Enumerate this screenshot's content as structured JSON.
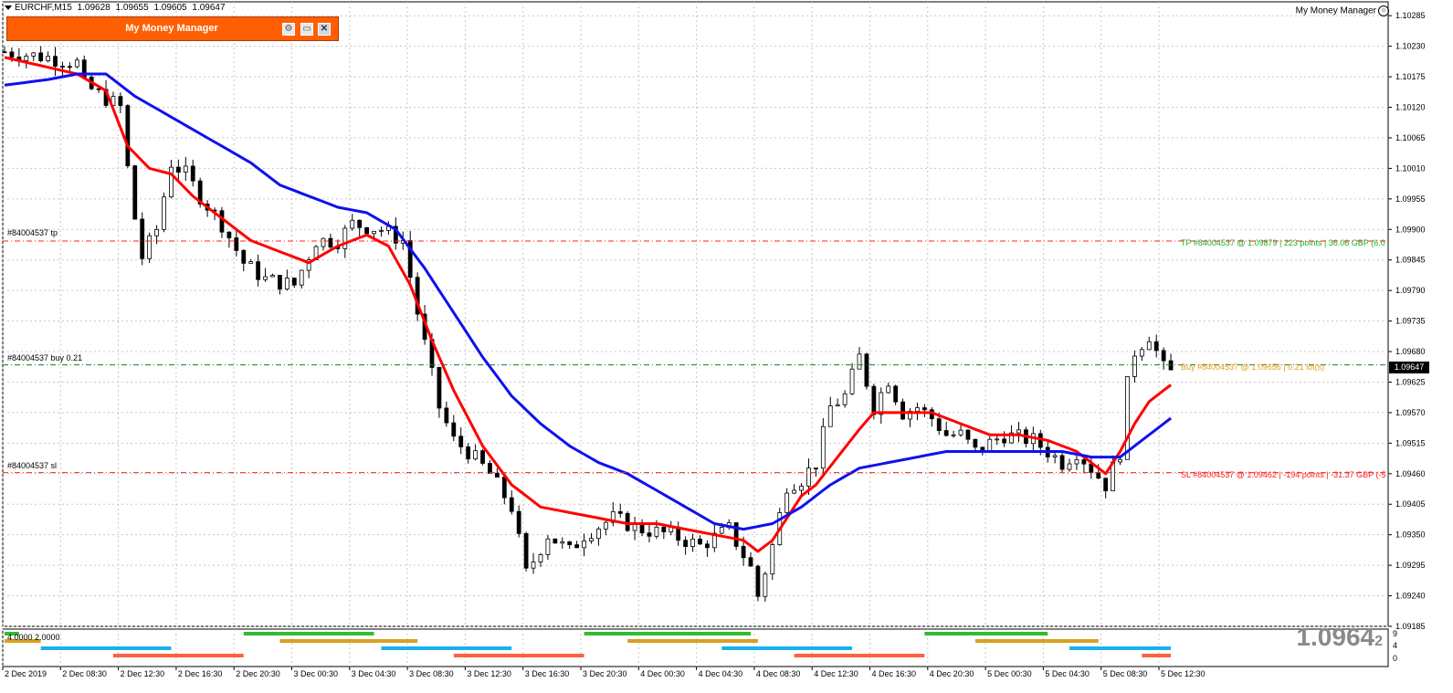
{
  "header": {
    "symbol": "EURCHF,M15",
    "open": "1.09628",
    "high": "1.09655",
    "low": "1.09605",
    "close": "1.09647"
  },
  "window_label": "My Money Manager",
  "panel": {
    "title": "My Money Manager"
  },
  "current_price": {
    "big": "1.0964",
    "big_small": "2",
    "tag": "1.09647"
  },
  "order_lines": {
    "tp": {
      "left": "#84004537 tp",
      "right": "TP #84004537 @ 1.09879 | 223 points | 36.06 GBP (6.0"
    },
    "buy": {
      "left": "#84004537 buy 0.21",
      "right": "Buy #84004537 @ 1.09656 | 0.21 lot(s)"
    },
    "sl": {
      "left": "#84004537 sl",
      "right": "SL #84004537 @ 1.09462 | -194 points | -31.37 GBP (-5"
    }
  },
  "indicator": {
    "label": "4.0000 2.0000",
    "scale": [
      "9",
      "4",
      "0"
    ]
  },
  "colors": {
    "candle": "#000000",
    "fast_ma": "#ff0000",
    "slow_ma": "#1010ee",
    "tp": "#22aa22",
    "buy": "#e0a020",
    "sl": "#ff0000",
    "panel": "#ff5f00"
  },
  "chart_data": {
    "type": "candlestick",
    "symbol": "EURCHF",
    "timeframe": "M15",
    "ylim": [
      1.09185,
      1.1031
    ],
    "y_ticks": [
      "1.10285",
      "1.10230",
      "1.10175",
      "1.10120",
      "1.10065",
      "1.10010",
      "1.09955",
      "1.09900",
      "1.09845",
      "1.09790",
      "1.09735",
      "1.09680",
      "1.09625",
      "1.09570",
      "1.09515",
      "1.09460",
      "1.09405",
      "1.09350",
      "1.09295",
      "1.09240",
      "1.09185"
    ],
    "x_ticks": [
      "2 Dec 2019",
      "2 Dec 08:30",
      "2 Dec 12:30",
      "2 Dec 16:30",
      "2 Dec 20:30",
      "3 Dec 00:30",
      "3 Dec 04:30",
      "3 Dec 08:30",
      "3 Dec 12:30",
      "3 Dec 16:30",
      "3 Dec 20:30",
      "4 Dec 00:30",
      "4 Dec 04:30",
      "4 Dec 08:30",
      "4 Dec 12:30",
      "4 Dec 16:30",
      "4 Dec 20:30",
      "5 Dec 00:30",
      "5 Dec 04:30",
      "5 Dec 08:30",
      "5 Dec 12:30"
    ],
    "price_path": [
      [
        0,
        1.1022
      ],
      [
        6,
        1.1021
      ],
      [
        10,
        1.102
      ],
      [
        11,
        1.1016
      ],
      [
        16,
        1.1012
      ],
      [
        17,
        1.1001
      ],
      [
        18,
        1.0992
      ],
      [
        19,
        1.0985
      ],
      [
        21,
        1.099
      ],
      [
        23,
        1.1002
      ],
      [
        25,
        1.1
      ],
      [
        27,
        1.0996
      ],
      [
        30,
        1.0991
      ],
      [
        33,
        1.0984
      ],
      [
        36,
        1.0981
      ],
      [
        40,
        1.098
      ],
      [
        43,
        1.0988
      ],
      [
        46,
        1.0988
      ],
      [
        48,
        1.0991
      ],
      [
        52,
        1.099
      ],
      [
        55,
        1.0988
      ],
      [
        57,
        1.0975
      ],
      [
        60,
        1.0958
      ],
      [
        62,
        1.0952
      ],
      [
        64,
        1.095
      ],
      [
        67,
        1.0946
      ],
      [
        70,
        1.094
      ],
      [
        72,
        1.0928
      ],
      [
        75,
        1.0935
      ],
      [
        78,
        1.0932
      ],
      [
        80,
        1.0935
      ],
      [
        84,
        1.0938
      ],
      [
        88,
        1.0936
      ],
      [
        92,
        1.0935
      ],
      [
        96,
        1.0933
      ],
      [
        100,
        1.0936
      ],
      [
        103,
        1.0929
      ],
      [
        104,
        1.0924
      ],
      [
        106,
        1.0933
      ],
      [
        108,
        1.0944
      ],
      [
        110,
        1.0945
      ],
      [
        112,
        1.0948
      ],
      [
        114,
        1.0958
      ],
      [
        116,
        1.096
      ],
      [
        118,
        1.0967
      ],
      [
        120,
        1.0958
      ],
      [
        122,
        1.0963
      ],
      [
        124,
        1.0957
      ],
      [
        126,
        1.0958
      ],
      [
        128,
        1.0956
      ],
      [
        130,
        1.0953
      ],
      [
        132,
        1.0953
      ],
      [
        134,
        1.095
      ],
      [
        138,
        1.0953
      ],
      [
        142,
        1.0952
      ],
      [
        144,
        1.095
      ],
      [
        146,
        1.0948
      ],
      [
        148,
        1.095
      ],
      [
        150,
        1.0947
      ],
      [
        152,
        1.0944
      ],
      [
        154,
        1.095
      ],
      [
        155,
        1.0962
      ],
      [
        156,
        1.0968
      ],
      [
        158,
        1.0971
      ],
      [
        160,
        1.0965
      ],
      [
        161,
        1.0964
      ]
    ],
    "series": [
      {
        "name": "fast MA",
        "path": [
          [
            0,
            1.1021
          ],
          [
            10,
            1.1018
          ],
          [
            14,
            1.1015
          ],
          [
            17,
            1.1005
          ],
          [
            20,
            1.1001
          ],
          [
            23,
            1.1
          ],
          [
            26,
            1.0996
          ],
          [
            30,
            1.0992
          ],
          [
            34,
            1.0988
          ],
          [
            38,
            1.0986
          ],
          [
            42,
            1.0984
          ],
          [
            46,
            1.0987
          ],
          [
            50,
            1.0989
          ],
          [
            53,
            1.0987
          ],
          [
            56,
            1.098
          ],
          [
            59,
            1.097
          ],
          [
            62,
            1.0961
          ],
          [
            66,
            1.0951
          ],
          [
            70,
            1.0944
          ],
          [
            74,
            1.094
          ],
          [
            78,
            1.0939
          ],
          [
            82,
            1.0938
          ],
          [
            86,
            1.0937
          ],
          [
            90,
            1.0937
          ],
          [
            94,
            1.0936
          ],
          [
            98,
            1.0935
          ],
          [
            102,
            1.0934
          ],
          [
            104,
            1.0932
          ],
          [
            106,
            1.0934
          ],
          [
            108,
            1.0938
          ],
          [
            110,
            1.0942
          ],
          [
            112,
            1.0944
          ],
          [
            115,
            1.0949
          ],
          [
            118,
            1.0954
          ],
          [
            120,
            1.0957
          ],
          [
            124,
            1.0957
          ],
          [
            128,
            1.0957
          ],
          [
            132,
            1.0955
          ],
          [
            136,
            1.0953
          ],
          [
            140,
            1.0953
          ],
          [
            144,
            1.0952
          ],
          [
            148,
            1.095
          ],
          [
            150,
            1.0948
          ],
          [
            152,
            1.0946
          ],
          [
            154,
            1.095
          ],
          [
            156,
            1.0955
          ],
          [
            158,
            1.0959
          ],
          [
            160,
            1.0961
          ],
          [
            161,
            1.0962
          ]
        ]
      },
      {
        "name": "slow MA",
        "path": [
          [
            0,
            1.1016
          ],
          [
            6,
            1.1017
          ],
          [
            10,
            1.1018
          ],
          [
            14,
            1.1018
          ],
          [
            18,
            1.1014
          ],
          [
            22,
            1.1011
          ],
          [
            26,
            1.1008
          ],
          [
            30,
            1.1005
          ],
          [
            34,
            1.1002
          ],
          [
            38,
            1.0998
          ],
          [
            42,
            1.0996
          ],
          [
            46,
            1.0994
          ],
          [
            50,
            1.0993
          ],
          [
            54,
            1.099
          ],
          [
            58,
            1.0983
          ],
          [
            62,
            1.0975
          ],
          [
            66,
            1.0967
          ],
          [
            70,
            1.096
          ],
          [
            74,
            1.0955
          ],
          [
            78,
            1.0951
          ],
          [
            82,
            1.0948
          ],
          [
            86,
            1.0946
          ],
          [
            90,
            1.0943
          ],
          [
            94,
            1.094
          ],
          [
            98,
            1.0937
          ],
          [
            102,
            1.0936
          ],
          [
            106,
            1.0937
          ],
          [
            110,
            1.094
          ],
          [
            114,
            1.0944
          ],
          [
            118,
            1.0947
          ],
          [
            122,
            1.0948
          ],
          [
            126,
            1.0949
          ],
          [
            130,
            1.095
          ],
          [
            134,
            1.095
          ],
          [
            138,
            1.095
          ],
          [
            142,
            1.095
          ],
          [
            146,
            1.095
          ],
          [
            150,
            1.0949
          ],
          [
            154,
            1.0949
          ],
          [
            156,
            1.0951
          ],
          [
            158,
            1.0953
          ],
          [
            160,
            1.0955
          ],
          [
            161,
            1.0956
          ]
        ]
      }
    ],
    "levels": {
      "tp": 1.09879,
      "buy": 1.09656,
      "sl": 1.09462
    },
    "indicator_bars": [
      {
        "level": 4,
        "color": "#33bb33",
        "segments": [
          [
            0,
            2
          ],
          [
            33,
            51
          ],
          [
            80,
            103
          ],
          [
            127,
            144
          ]
        ]
      },
      {
        "level": 3,
        "color": "#d9a020",
        "segments": [
          [
            0,
            5
          ],
          [
            38,
            57
          ],
          [
            86,
            104
          ],
          [
            134,
            151
          ]
        ]
      },
      {
        "level": 2,
        "color": "#1ab0e8",
        "segments": [
          [
            5,
            23
          ],
          [
            52,
            70
          ],
          [
            99,
            117
          ],
          [
            147,
            161
          ]
        ]
      },
      {
        "level": 1,
        "color": "#ff6040",
        "segments": [
          [
            15,
            33
          ],
          [
            62,
            80
          ],
          [
            109,
            127
          ],
          [
            157,
            161
          ]
        ]
      }
    ],
    "grid": true
  }
}
